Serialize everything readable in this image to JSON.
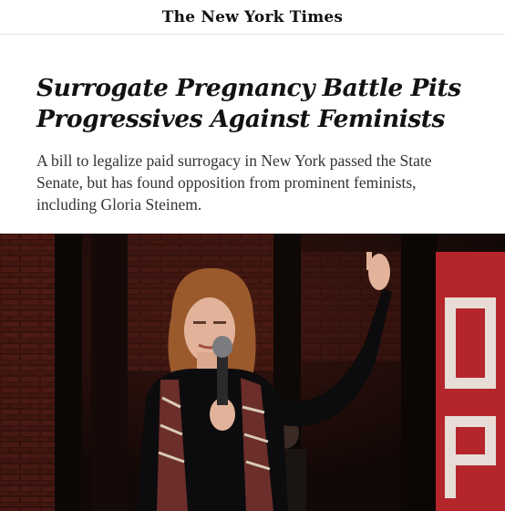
{
  "masthead": {
    "logo_text": "The New York Times"
  },
  "article": {
    "headline_line1": "Surrogate Pregnancy Battle Pits",
    "headline_line2": "Progressives Against Feminists",
    "summary": "A bill to legalize paid surrogacy in New York passed the State Senate, but has found opposition from prominent feminists, including Gloria Steinem."
  },
  "photo": {
    "sign_letters": [
      "D",
      "P"
    ],
    "colors": {
      "background": "#1a0f0c",
      "sign_red": "#b5262b",
      "brick": "#5a1e16"
    }
  }
}
